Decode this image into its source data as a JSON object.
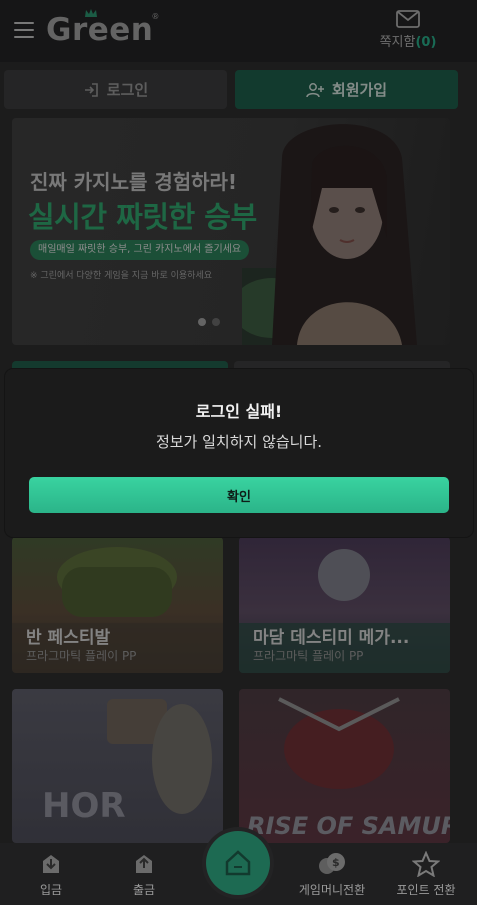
{
  "header": {
    "logo_text": "Green",
    "logo_reg": "®",
    "inbox_label": "쪽지함",
    "inbox_count": "(0)"
  },
  "auth": {
    "login_label": "로그인",
    "signup_label": "회원가입"
  },
  "banner": {
    "headline": "진짜 카지노를 경험하라!",
    "tagline": "실시간 짜릿한 승부",
    "pill": "매일매일 짜릿한 승부, 그린 카지노에서 즐기세요",
    "note": "※ 그린에서 다양한 게임을 지금 바로 이용하세요"
  },
  "games": [
    {
      "title": "반 페스티발",
      "provider": "프라그마틱 플레이 PP"
    },
    {
      "title": "마담 데스티미 메가...",
      "provider": "프라그마틱 플레이 PP"
    },
    {
      "title": "",
      "provider": ""
    },
    {
      "title": "",
      "provider": ""
    }
  ],
  "modal": {
    "title": "로그인 실패!",
    "message": "정보가 일치하지 않습니다.",
    "confirm_label": "확인"
  },
  "bottom_nav": {
    "items": [
      {
        "label": "입금",
        "icon": "deposit-icon"
      },
      {
        "label": "출금",
        "icon": "withdraw-icon"
      },
      {
        "label": "",
        "icon": "home-icon"
      },
      {
        "label": "게임머니전환",
        "icon": "coin-exchange-icon"
      },
      {
        "label": "포인트 전환",
        "icon": "star-icon"
      }
    ]
  },
  "colors": {
    "accent": "#2bb489",
    "accent_dark": "#1d5a48",
    "background": "#2b2b2c",
    "modal_bg": "#1b1b1b"
  }
}
